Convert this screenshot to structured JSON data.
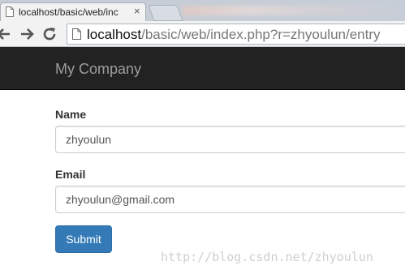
{
  "browser": {
    "tab": {
      "title": "localhost/basic/web/inc",
      "close": "×"
    },
    "address": {
      "host": "localhost",
      "path": "/basic/web/index.php?r=zhyoulun/entry"
    }
  },
  "navbar": {
    "brand": "My Company"
  },
  "form": {
    "name_label": "Name",
    "name_value": "zhyoulun",
    "email_label": "Email",
    "email_value": "zhyoulun@gmail.com",
    "submit_label": "Submit"
  },
  "watermark": "http://blog.csdn.net/zhyoulun",
  "colors": {
    "navbar": "#222222",
    "primary_button": "#337ab7",
    "brand_text": "#9d9d9d"
  }
}
